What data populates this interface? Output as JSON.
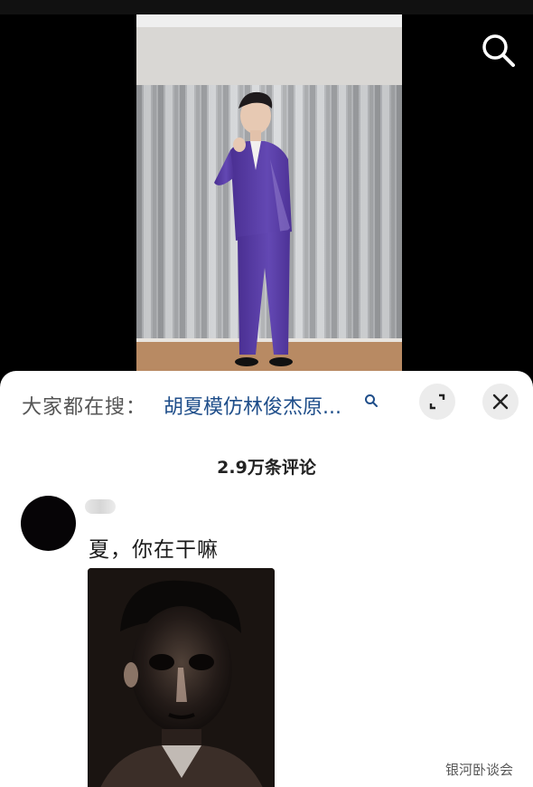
{
  "search_bar": {
    "prefix": "大家都在搜：",
    "term": "胡夏模仿林俊杰原..."
  },
  "comments": {
    "count_label": "2.9万条评论",
    "items": [
      {
        "text": "夏，你在干嘛"
      }
    ]
  },
  "watermark": "银河卧谈会",
  "icons": {
    "top_right": "search-icon",
    "term_suffix": "search-icon",
    "expand": "expand-icon",
    "close": "close-icon"
  },
  "colors": {
    "search_term": "#1f4e8a",
    "button_bg": "#ececec",
    "suit": "#5b3fa6"
  }
}
